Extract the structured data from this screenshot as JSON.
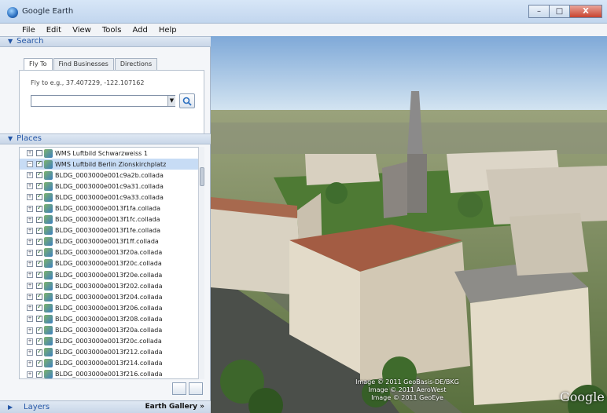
{
  "window": {
    "title": "Google Earth",
    "controls": [
      "–",
      "□",
      "X"
    ]
  },
  "menu": [
    "File",
    "Edit",
    "View",
    "Tools",
    "Add",
    "Help"
  ],
  "search": {
    "header": "Search",
    "tabs": [
      "Fly To",
      "Find Businesses",
      "Directions"
    ],
    "hint": "Fly to e.g., 37.407229, -122.107162",
    "input_value": ""
  },
  "places": {
    "header": "Places",
    "items": [
      {
        "label": "WMS Luftbild Schwarzweiss 1",
        "checked": false,
        "selected": false
      },
      {
        "label": "WMS Luftbild Berlin Zionskirchplatz",
        "checked": true,
        "selected": true
      },
      {
        "label": "BLDG_0003000e001c9a2b.collada",
        "checked": true,
        "selected": false
      },
      {
        "label": "BLDG_0003000e001c9a31.collada",
        "checked": true,
        "selected": false
      },
      {
        "label": "BLDG_0003000e001c9a33.collada",
        "checked": true,
        "selected": false
      },
      {
        "label": "BLDG_0003000e0013f1fa.collada",
        "checked": true,
        "selected": false
      },
      {
        "label": "BLDG_0003000e0013f1fc.collada",
        "checked": true,
        "selected": false
      },
      {
        "label": "BLDG_0003000e0013f1fe.collada",
        "checked": true,
        "selected": false
      },
      {
        "label": "BLDG_0003000e0013f1ff.collada",
        "checked": true,
        "selected": false
      },
      {
        "label": "BLDG_0003000e0013f20a.collada",
        "checked": true,
        "selected": false
      },
      {
        "label": "BLDG_0003000e0013f20c.collada",
        "checked": true,
        "selected": false
      },
      {
        "label": "BLDG_0003000e0013f20e.collada",
        "checked": true,
        "selected": false
      },
      {
        "label": "BLDG_0003000e0013f202.collada",
        "checked": true,
        "selected": false
      },
      {
        "label": "BLDG_0003000e0013f204.collada",
        "checked": true,
        "selected": false
      },
      {
        "label": "BLDG_0003000e0013f206.collada",
        "checked": true,
        "selected": false
      },
      {
        "label": "BLDG_0003000e0013f208.collada",
        "checked": true,
        "selected": false
      },
      {
        "label": "BLDG_0003000e0013f20a.collada",
        "checked": true,
        "selected": false
      },
      {
        "label": "BLDG_0003000e0013f20c.collada",
        "checked": true,
        "selected": false
      },
      {
        "label": "BLDG_0003000e0013f212.collada",
        "checked": true,
        "selected": false
      },
      {
        "label": "BLDG_0003000e0013f214.collada",
        "checked": true,
        "selected": false
      },
      {
        "label": "BLDG_0003000e0013f216.collada",
        "checked": true,
        "selected": false
      }
    ]
  },
  "layers": {
    "header": "Layers",
    "gallery": "Earth Gallery »"
  },
  "viewport": {
    "credits": [
      "Image © 2011 GeoBasis-DE/BKG",
      "Image © 2011 AeroWest",
      "Image © 2011 GeoEye"
    ],
    "logo": "Google"
  }
}
